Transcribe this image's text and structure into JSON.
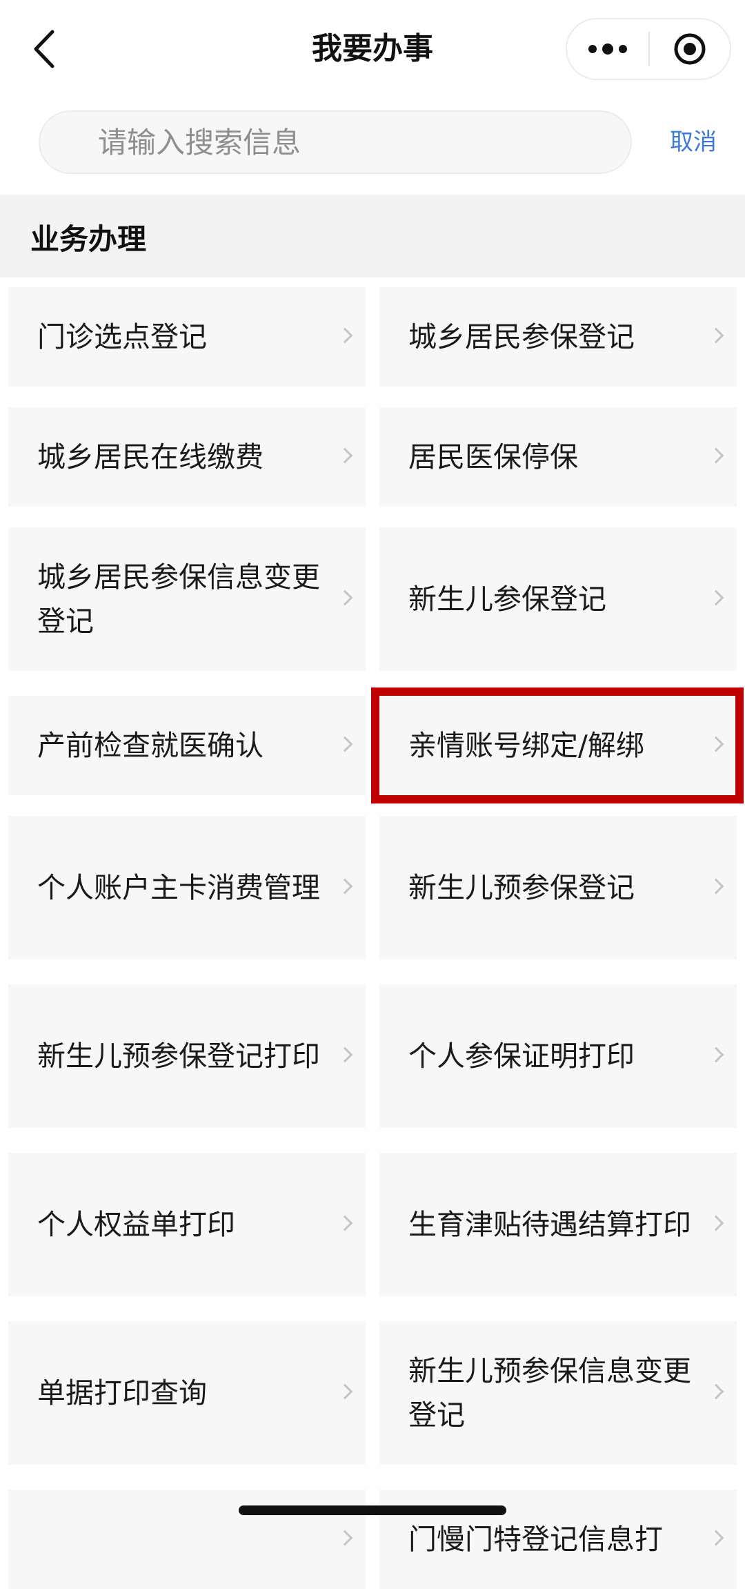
{
  "navbar": {
    "title": "我要办事",
    "back_icon": "chevron-left-icon",
    "more_icon": "more-dots-icon",
    "close_icon": "target-close-icon"
  },
  "search": {
    "placeholder": "请输入搜索信息",
    "value": "",
    "cancel_label": "取消"
  },
  "section": {
    "title": "业务办理",
    "items": [
      {
        "label": "门诊选点登记"
      },
      {
        "label": "城乡居民参保登记"
      },
      {
        "label": "城乡居民在线缴费"
      },
      {
        "label": "居民医保停保"
      },
      {
        "label": "城乡居民参保信息变更登记"
      },
      {
        "label": "新生儿参保登记"
      },
      {
        "label": "产前检查就医确认"
      },
      {
        "label": "亲情账号绑定/解绑",
        "highlighted": true
      },
      {
        "label": "个人账户主卡消费管理"
      },
      {
        "label": "新生儿预参保登记"
      },
      {
        "label": "新生儿预参保登记打印"
      },
      {
        "label": "个人参保证明打印"
      },
      {
        "label": "个人权益单打印"
      },
      {
        "label": "生育津贴待遇结算打印"
      },
      {
        "label": "单据打印查询"
      },
      {
        "label": "新生儿预参保信息变更登记"
      },
      {
        "label": ""
      },
      {
        "label": "门慢门特登记信息打"
      }
    ]
  },
  "colors": {
    "accent": "#3b78d8",
    "highlight": "#c00000",
    "card_bg": "#f7f7f7",
    "section_bg": "#f2f2f2"
  }
}
